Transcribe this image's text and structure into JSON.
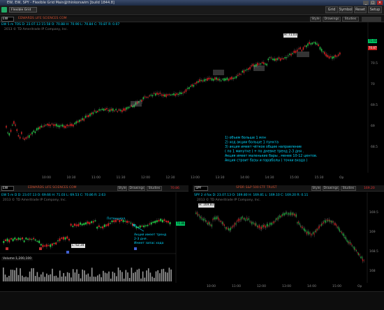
{
  "window": {
    "title": "EW, EW, SPY - Flexible Grid Main@thinkorswim [build 1844.8]"
  },
  "menubar": {
    "tab_label": "Flexible Grid",
    "buttons": [
      "Grid",
      "Symbol",
      "Reset",
      "Setup"
    ],
    "time": "23:07"
  },
  "top_chart": {
    "symbol": "EW",
    "name": "EDWARDS LIFE SCIENCES COM",
    "style_label": "Style",
    "drawings_label": "Drawings",
    "studies_label": "Studies",
    "info": "EW 5 m TOS  D: 23.07.13 15:58  O: 70.88  H: 70.90  L: 70.84  C: 70.87  R: 0.07",
    "copyright": "2013 © TD Ameritrade IP Company, Inc.",
    "high_label": "H: 71.03",
    "price_ticks": [
      "71",
      "70.5",
      "70",
      "69.5",
      "69",
      "68.5"
    ],
    "time_ticks": [
      "10:00",
      "10:30",
      "11:00",
      "11:30",
      "12:00",
      "12:30",
      "13:00",
      "13:30",
      "14:00",
      "14:30",
      "15:00",
      "15:30",
      "Op"
    ],
    "right_tags": [
      "71.03",
      "70.87"
    ],
    "annotation": [
      "1) объем больше 1 млн",
      "2) ход акции больше 1 пункта",
      "3) акция имеет чёткое общее направление",
      "( по 1 минутке ) + по дневке тренд 2-3 дня .",
      "Акция имеет маленькие бары , менее 10-12 центов.",
      "Акция строит базы и параболы ( точки входа )"
    ]
  },
  "bottom_left": {
    "symbol": "EW",
    "name": "EDWARDS LIFE SCIENCES COM",
    "price": "70.86",
    "style_label": "Style",
    "drawings_label": "Drawings",
    "studies_label": "Studies",
    "info": "EW 5 m D  D: 23.07.13  O: 69.66  H: 71.03  L: 69.53  C: 70.86  R: 2.63",
    "copyright": "2013 © TD Ameritrade IP Company, Inc.",
    "low_label": "L: 62.34",
    "ann1": "Потенциал",
    "ann2": [
      "Акция имеет тренд",
      "2-3 дня .",
      "Имеет запас хода"
    ],
    "volume_label": "Volume  1,200,100",
    "right_tag": "70.86"
  },
  "bottom_right": {
    "symbol": "SPY",
    "name": "SPDR S&P 500 ETF TRUST",
    "price": "169.20",
    "style_label": "Style",
    "drawings_label": "Drawings",
    "studies_label": "Studies",
    "info": "SPY 2 d fox  D: 23.07.13  O: 169.80  H: 169.81  L: 169.10  C: 169.20  R: 0.11",
    "copyright": "2013 © TD Ameritrade IP Company, Inc.",
    "high_label": "H: 169.83",
    "price_ticks": [
      "169.5",
      "169",
      "168.5",
      "168"
    ],
    "time_ticks": [
      "10:00",
      "11:00",
      "12:00",
      "13:00",
      "14:00",
      "15:00",
      "Op"
    ]
  }
}
